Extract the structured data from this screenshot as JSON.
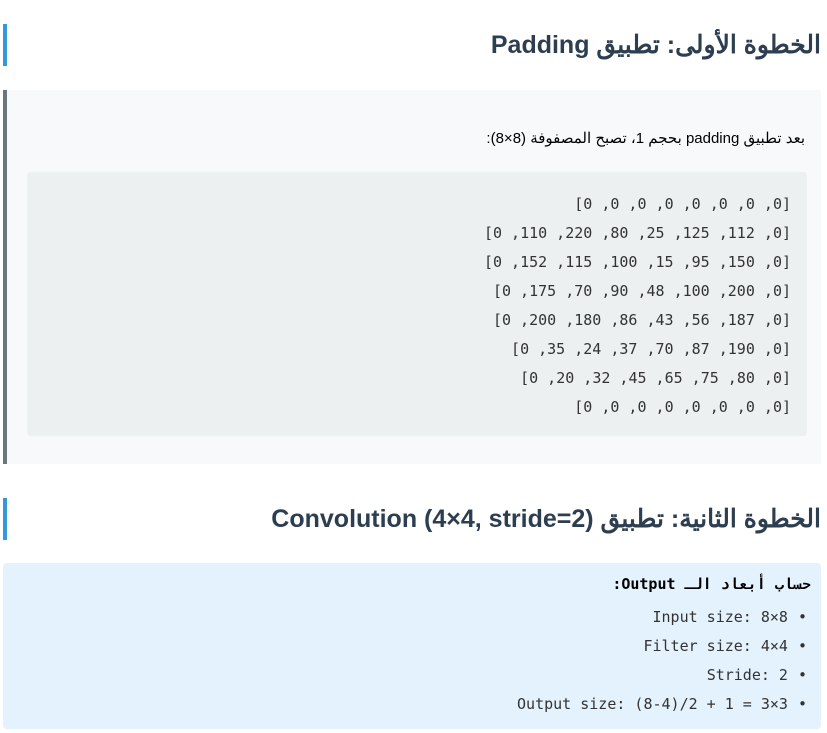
{
  "step1": {
    "heading": "الخطوة الأولى: تطبيق Padding",
    "description": "بعد تطبيق padding بحجم 1، تصبح المصفوفة (8×8):",
    "matrix_rows": [
      "[0, 0, 0, 0, 0, 0, 0, 0]",
      "[0, 112, 125, 25, 80, 220, 110, 0]",
      "[0, 150, 95, 15, 100, 115, 152, 0]",
      "[0, 200, 100, 48, 90, 70, 175, 0]",
      "[0, 187, 56, 43, 86, 180, 200, 0]",
      "[0, 190, 87, 70, 37, 24, 35, 0]",
      "[0, 80, 75, 65, 45, 32, 20, 0]",
      "[0, 0, 0, 0, 0, 0, 0, 0]"
    ]
  },
  "step2": {
    "heading": "الخطوة الثانية: تطبيق Convolution (4×4, stride=2)",
    "calc_title": "حساب أبعاد الـ Output:",
    "bullet": "•",
    "items": [
      "Input size: 8×8",
      "Filter size: 4×4",
      "Stride: 2",
      "Output size: (8-4)/2 + 1 = 3×3"
    ]
  }
}
